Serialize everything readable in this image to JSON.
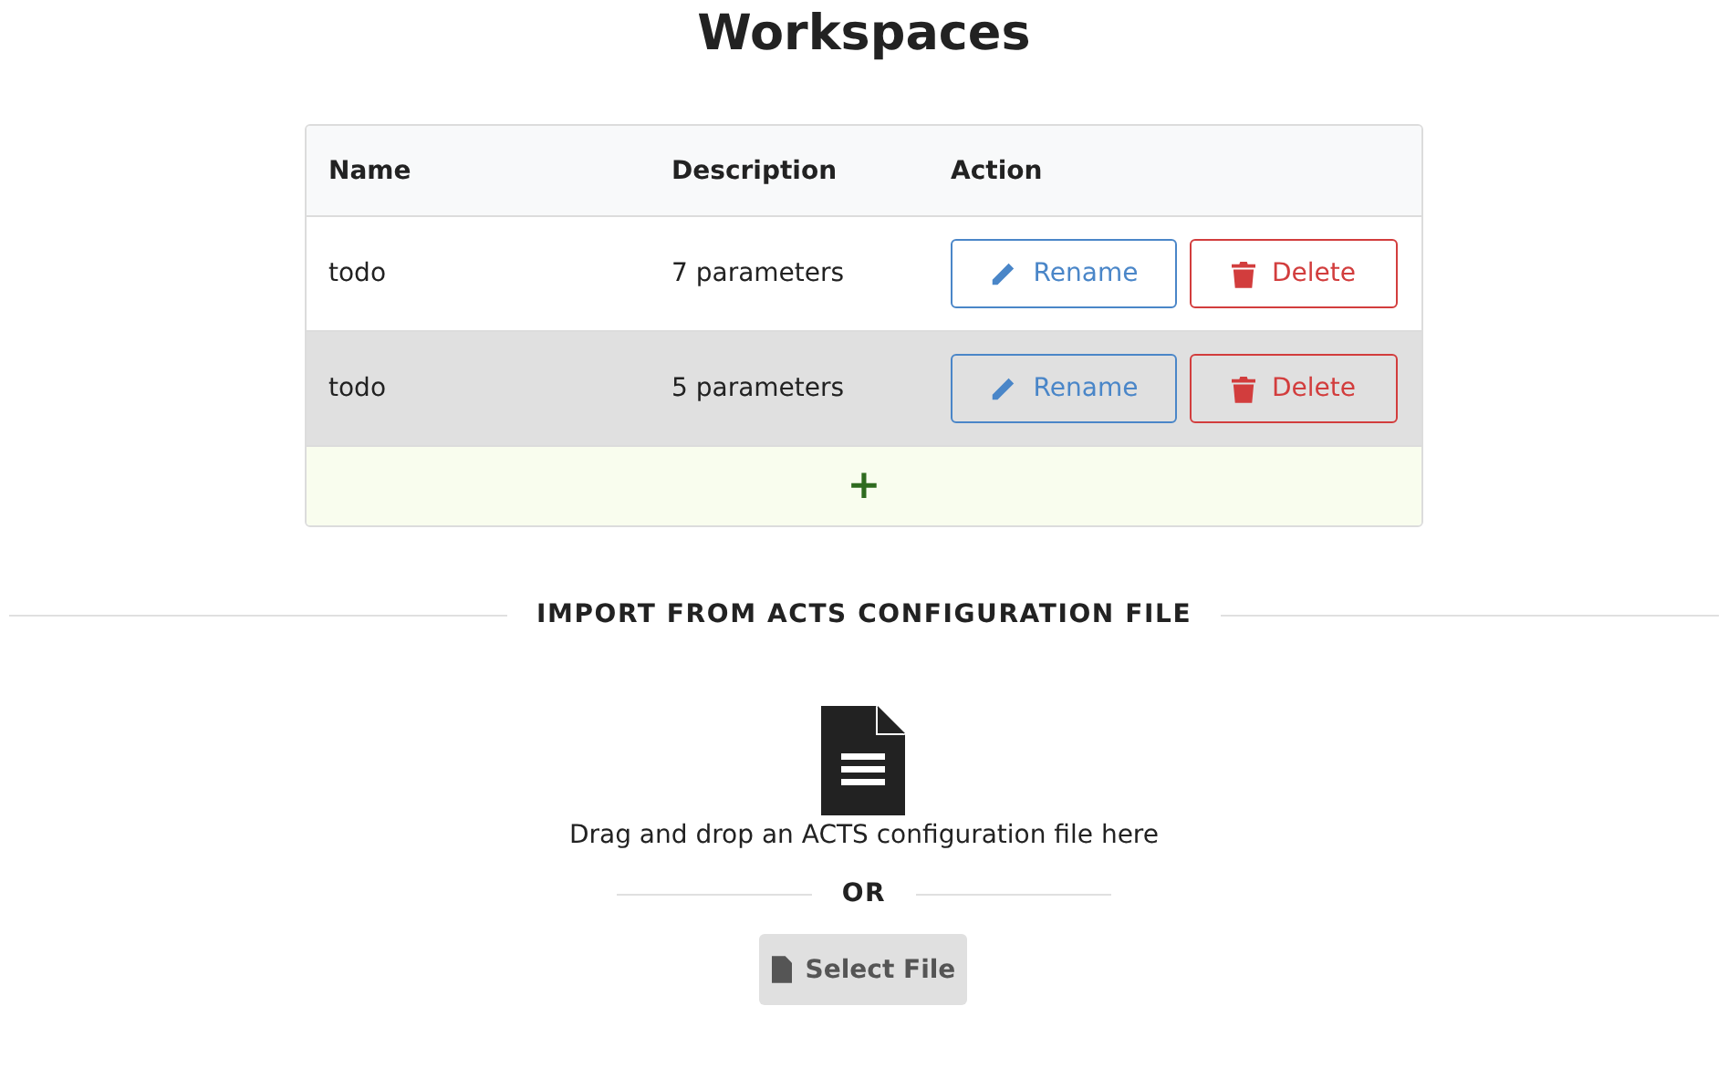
{
  "title": "Workspaces",
  "table": {
    "columns": [
      "Name",
      "Description",
      "Action"
    ],
    "rows": [
      {
        "name": "todo",
        "description": "7 parameters",
        "actions": [
          "Rename",
          "Delete"
        ],
        "selected": false
      },
      {
        "name": "todo",
        "description": "5 parameters",
        "actions": [
          "Rename",
          "Delete"
        ],
        "selected": true
      }
    ],
    "add_button": "+"
  },
  "import": {
    "heading": "IMPORT FROM ACTS CONFIGURATION FILE",
    "drop_text": "Drag and drop an ACTS configuration file here",
    "separator": "OR",
    "button": "Select File"
  }
}
